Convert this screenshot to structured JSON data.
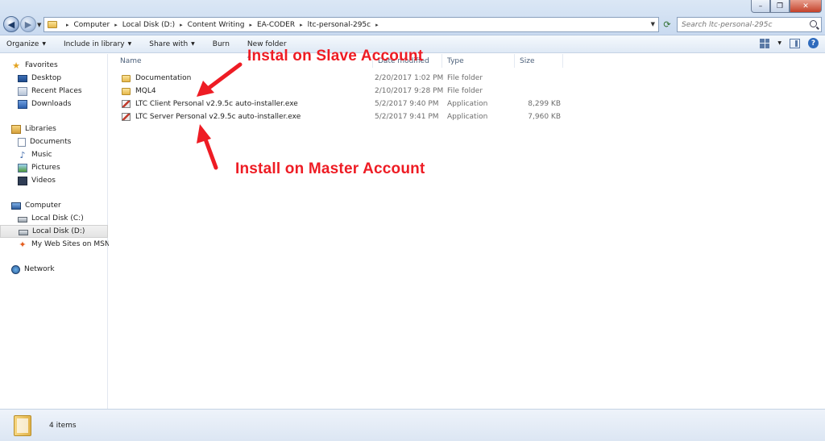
{
  "window": {
    "minimize_glyph": "–",
    "maximize_glyph": "❐",
    "close_glyph": "✕"
  },
  "address": {
    "breadcrumbs": [
      "Computer",
      "Local Disk (D:)",
      "Content Writing",
      "EA-CODER",
      "ltc-personal-295c"
    ],
    "separator": "▸"
  },
  "search": {
    "placeholder": "Search ltc-personal-295c"
  },
  "toolbar": {
    "organize": "Organize",
    "include_in_library": "Include in library",
    "share_with": "Share with",
    "burn": "Burn",
    "new_folder": "New folder"
  },
  "sidebar": {
    "favorites": {
      "label": "Favorites",
      "items": [
        "Desktop",
        "Recent Places",
        "Downloads"
      ]
    },
    "libraries": {
      "label": "Libraries",
      "items": [
        "Documents",
        "Music",
        "Pictures",
        "Videos"
      ]
    },
    "computer": {
      "label": "Computer",
      "items": [
        "Local Disk (C:)",
        "Local Disk (D:)",
        "My Web Sites on MSN"
      ],
      "selected": "Local Disk (D:)"
    },
    "network": {
      "label": "Network"
    }
  },
  "columns": {
    "name": "Name",
    "date": "Date modified",
    "type": "Type",
    "size": "Size"
  },
  "files": [
    {
      "name": "Documentation",
      "date": "2/20/2017 1:02 PM",
      "type": "File folder",
      "size": "",
      "icon": "folder-icon"
    },
    {
      "name": "MQL4",
      "date": "2/10/2017 9:28 PM",
      "type": "File folder",
      "size": "",
      "icon": "folder-icon"
    },
    {
      "name": "LTC Client Personal v2.9.5c auto-installer.exe",
      "date": "5/2/2017 9:40 PM",
      "type": "Application",
      "size": "8,299 KB",
      "icon": "exe-icon"
    },
    {
      "name": "LTC Server Personal v2.9.5c auto-installer.exe",
      "date": "5/2/2017 9:41 PM",
      "type": "Application",
      "size": "7,960 KB",
      "icon": "exe-icon"
    }
  ],
  "annotations": {
    "slave": "Instal on Slave Account",
    "master": "Install on Master Account",
    "color": "#ee1c24"
  },
  "status": {
    "item_count": "4 items"
  }
}
